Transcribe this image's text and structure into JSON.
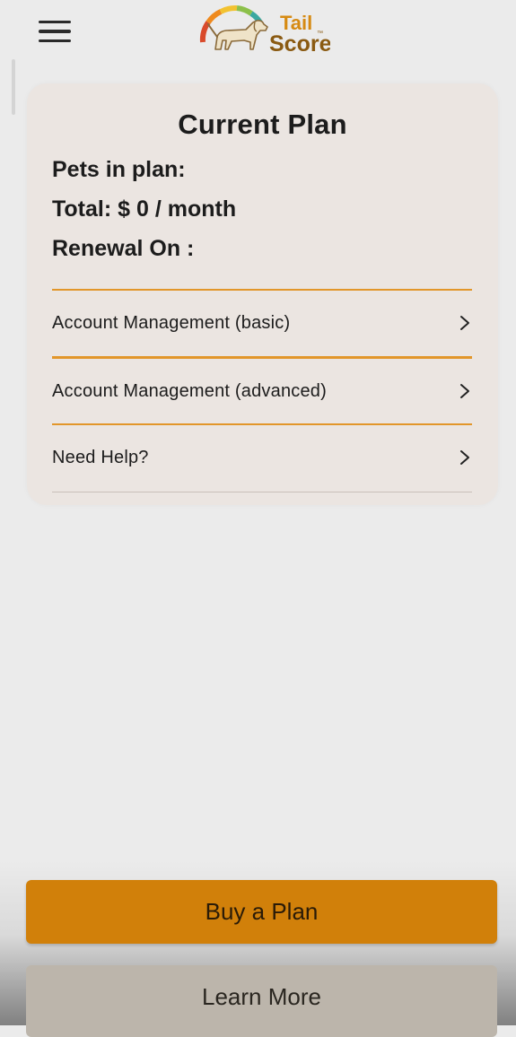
{
  "header": {
    "menu_icon": "hamburger-menu-icon",
    "logo": {
      "line1": "Tail",
      "line2": "Score",
      "tm": "™",
      "icon": "dog-gauge-logo-icon"
    }
  },
  "plan_card": {
    "title": "Current Plan",
    "pets_in_plan": "Pets in plan:",
    "total": "Total: $ 0 / month",
    "renewal": "Renewal On :",
    "menu_items": [
      {
        "label": "Account Management (basic)",
        "icon": "chevron-right-icon"
      },
      {
        "label": "Account Management (advanced)",
        "icon": "chevron-right-icon"
      },
      {
        "label": "Need Help?",
        "icon": "chevron-right-icon"
      }
    ]
  },
  "actions": {
    "buy_label": "Buy a Plan",
    "learn_label": "Learn More"
  },
  "colors": {
    "accent": "#d1800a",
    "divider": "#e2962a",
    "card_bg": "#ebe5e1",
    "page_bg": "#ebebeb",
    "learn_bg": "#bcb5ab"
  }
}
